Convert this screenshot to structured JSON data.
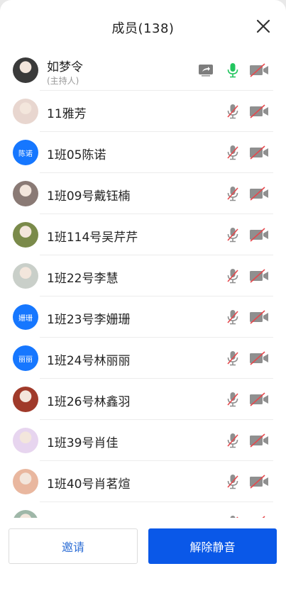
{
  "header": {
    "title": "成员(138)"
  },
  "members": [
    {
      "name": "如梦令",
      "role": "(主持人)",
      "avatar_type": "photo",
      "avatar_color": "#3a3a3a",
      "mic": "on",
      "camera": "off",
      "sharing": true
    },
    {
      "name": "11雅芳",
      "avatar_type": "photo",
      "avatar_color": "#e8d6cf",
      "mic": "off",
      "camera": "off"
    },
    {
      "name": "1班05陈诺",
      "avatar_type": "text",
      "avatar_text": "陈诺",
      "mic": "off",
      "camera": "off"
    },
    {
      "name": "1班09号戴钰楠",
      "avatar_type": "photo",
      "avatar_color": "#8a7a75",
      "mic": "off",
      "camera": "off"
    },
    {
      "name": "1班114号吴芹芹",
      "avatar_type": "photo",
      "avatar_color": "#7a8a4a",
      "mic": "off",
      "camera": "off"
    },
    {
      "name": "1班22号李慧",
      "avatar_type": "photo",
      "avatar_color": "#c9cfc9",
      "mic": "off",
      "camera": "off"
    },
    {
      "name": "1班23号李姗珊",
      "avatar_type": "text",
      "avatar_text": "姗珊",
      "mic": "off",
      "camera": "off"
    },
    {
      "name": "1班24号林丽丽",
      "avatar_type": "text",
      "avatar_text": "丽丽",
      "mic": "off",
      "camera": "off"
    },
    {
      "name": "1班26号林鑫羽",
      "avatar_type": "photo",
      "avatar_color": "#a03a2a",
      "mic": "off",
      "camera": "off"
    },
    {
      "name": "1班39号肖佳",
      "avatar_type": "photo",
      "avatar_color": "#e7d5ef",
      "mic": "off",
      "camera": "off"
    },
    {
      "name": "1班40号肖茗煊",
      "avatar_type": "photo",
      "avatar_color": "#e9b79f",
      "mic": "off",
      "camera": "off"
    },
    {
      "name": "",
      "avatar_type": "photo",
      "avatar_color": "#9fb7a8",
      "mic": "off",
      "camera": "off"
    }
  ],
  "footer": {
    "invite_label": "邀请",
    "unmute_all_label": "解除静音"
  },
  "colors": {
    "accent": "#0a58e8",
    "mic_on": "#22c55e",
    "muted_red": "#e5484d",
    "icon_grey": "#8f8f8f"
  }
}
